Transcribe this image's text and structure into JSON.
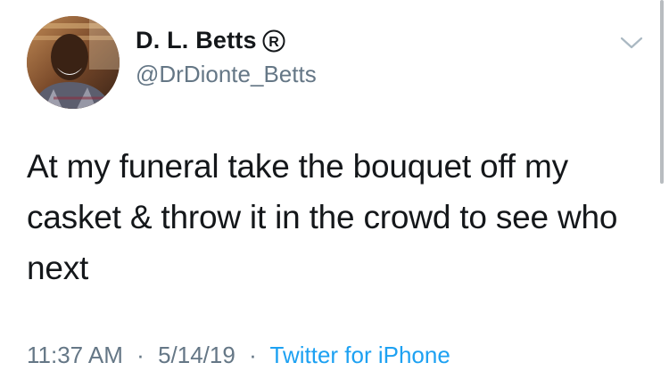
{
  "user": {
    "display_name": "D. L. Betts",
    "handle": "@DrDionte_Betts"
  },
  "icons": {
    "registered": "registered-trademark-icon",
    "menu": "chevron-down-icon",
    "avatar": "profile-avatar"
  },
  "tweet": {
    "text": "At my funeral take the bouquet off my casket & throw it in the crowd to see who next"
  },
  "meta": {
    "time": "11:37 AM",
    "separator": "·",
    "date": "5/14/19",
    "source": "Twitter for iPhone"
  },
  "colors": {
    "text": "#14171a",
    "secondary": "#657786",
    "link": "#1da1f2"
  }
}
